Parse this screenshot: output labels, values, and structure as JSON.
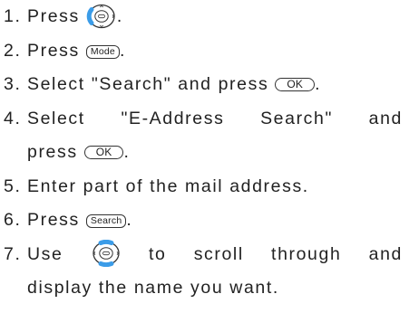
{
  "steps": [
    {
      "number": "1.",
      "before": "Press",
      "after": "."
    },
    {
      "number": "2.",
      "before": "Press",
      "key": "Mode",
      "after": "."
    },
    {
      "number": "3.",
      "before": "Select \"Search\" and press",
      "key": "OK",
      "after": "."
    },
    {
      "number": "4.",
      "line1": "Select \"E-Address Search\" and",
      "line2_before": "press",
      "key": "OK",
      "after": "."
    },
    {
      "number": "5.",
      "text": "Enter part of the mail address."
    },
    {
      "number": "6.",
      "before": "Press",
      "key": "Search",
      "after": "."
    },
    {
      "number": "7.",
      "line1_before": "Use",
      "line1_after": "to scroll through and",
      "line2": "display the name you want."
    }
  ],
  "icons": {
    "step1_icon": "navigation-key-left-highlighted-icon",
    "step7_icon": "navigation-key-up-down-highlighted-icon"
  },
  "colors": {
    "text": "#222222",
    "highlight": "#3b9ce8"
  }
}
